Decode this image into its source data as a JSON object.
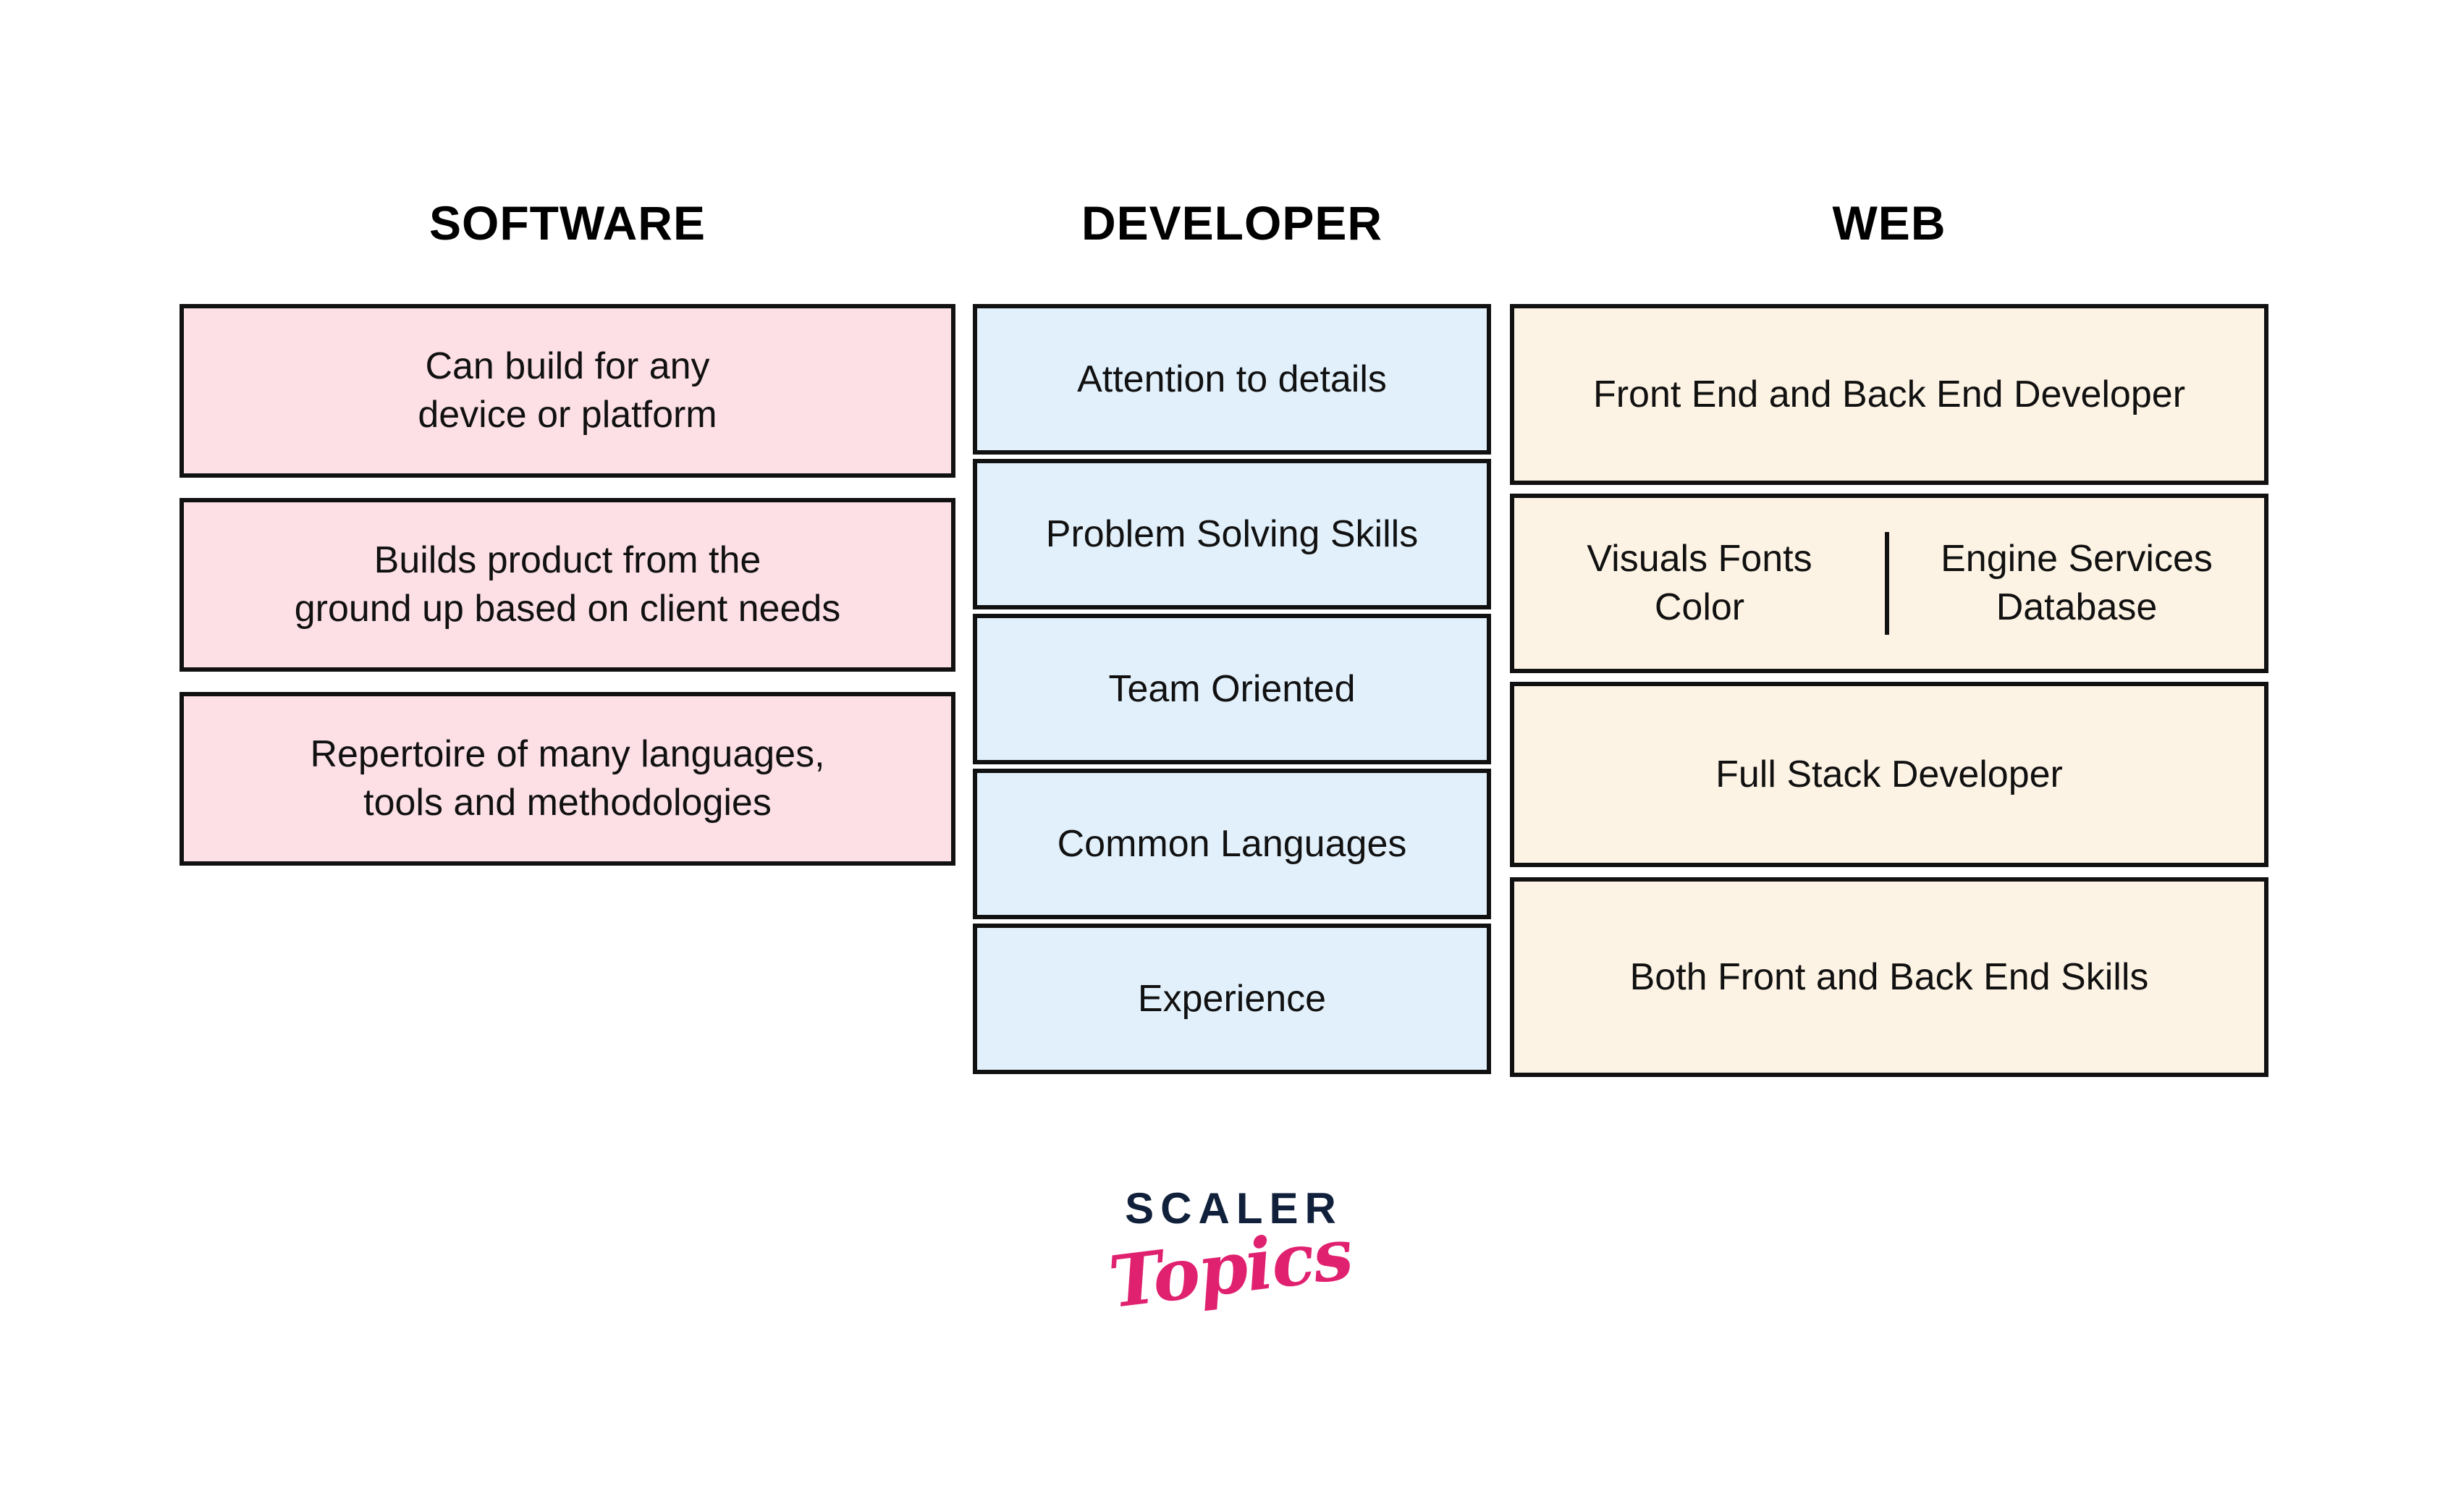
{
  "diagram": {
    "title_row": {
      "software": "SOFTWARE",
      "developer": "DEVELOPER",
      "web": "WEB"
    },
    "columns": [
      {
        "id": "software",
        "header": "SOFTWARE",
        "color": "#FCE0E6",
        "items": [
          "Can build for any\ndevice or platform",
          "Builds product from the\nground up based on client needs",
          "Repertoire of many languages,\ntools and methodologies"
        ]
      },
      {
        "id": "developer",
        "header": "DEVELOPER",
        "color": "#E2F0FB",
        "items": [
          "Attention to details",
          "Problem Solving Skills",
          "Team Oriented",
          "Common Languages",
          "Experience"
        ]
      },
      {
        "id": "web",
        "header": "WEB",
        "color": "#FDF3E4",
        "items": [
          "Front End and Back End Developer",
          "Full Stack Developer",
          "Both Front and Back End Skills"
        ],
        "split_item": {
          "left": "Visuals Fonts\nColor",
          "right": "Engine Services\nDatabase"
        }
      }
    ],
    "logo": {
      "primary": "SCALER",
      "secondary": "Topics",
      "primary_color": "#11213b",
      "secondary_color": "#e0216f"
    },
    "colors": {
      "background": "#ffffff",
      "border": "#111111",
      "pink": "#FCE0E6",
      "blue": "#E2F0FB",
      "cream": "#FDF3E4"
    }
  }
}
